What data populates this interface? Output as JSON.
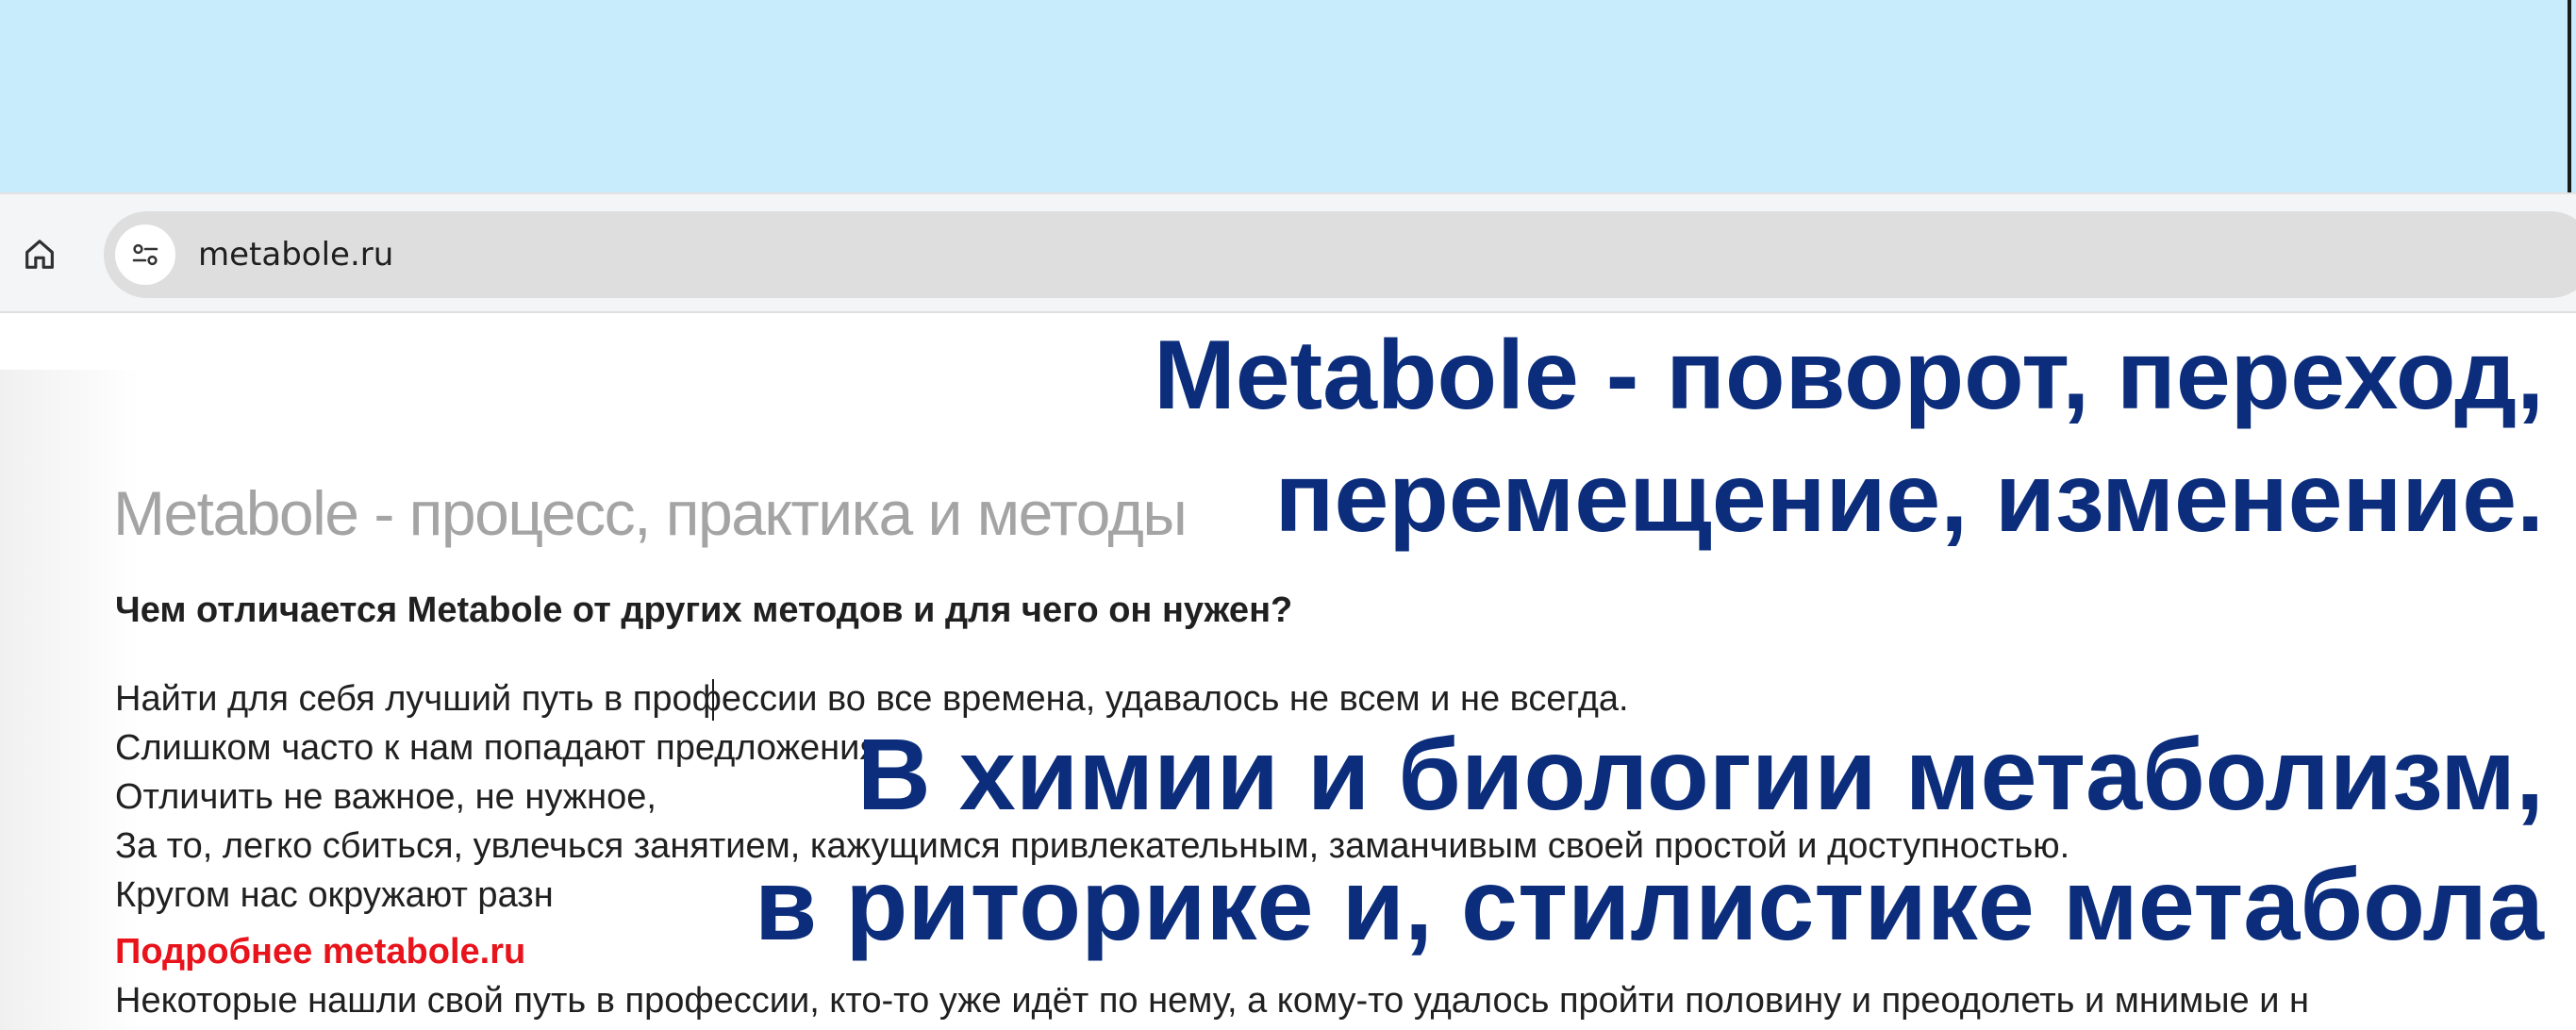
{
  "browser": {
    "url": "metabole.ru",
    "icons": {
      "home": "home-icon",
      "site_info": "tune-icon"
    }
  },
  "article": {
    "title": "Metabole - процесс, практика и методы",
    "question": "Чем отличается Metabole от других методов и для чего он нужен?",
    "lines": [
      "Найти для себя лучший путь в профессии во все времена, удавалось  не всем и не всегда.",
      "Слишком часто к нам попадают предложения",
      "Отличить не важное, не нужное,",
      "За то, легко сбиться, увлечься занятием, кажущимся привлекательным, заманчивым своей простой и доступностью.",
      "Кругом нас окружают разн",
      "Некоторые нашли свой путь в профессии, кто-то уже идёт по нему, а кому-то удалось пройти половину и преодолеть и мнимые и н"
    ],
    "more_link": "Подробнее metabole.ru"
  },
  "overlay": {
    "line1": "Metabole - поворот, переход,",
    "line2": "перемещение, изменение.",
    "line3": "В химии и биологии метаболизм,",
    "line4": "в риторике и, стилистике метабола"
  },
  "colors": {
    "top_band": "#c8ecfb",
    "overlay_text": "#0b2d7c",
    "link_red": "#e8131b",
    "title_gray": "#a4a4a4"
  }
}
